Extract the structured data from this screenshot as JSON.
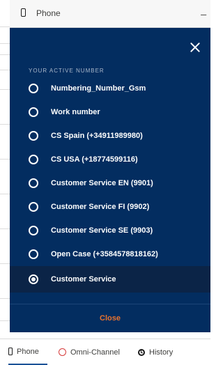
{
  "header": {
    "title": "Phone",
    "minimize_label": "_"
  },
  "panel": {
    "section_label": "YOUR ACTIVE NUMBER",
    "options": [
      {
        "label": "Numbering_Number_Gsm",
        "selected": false
      },
      {
        "label": "Work number",
        "selected": false
      },
      {
        "label": "CS Spain (+34911989980)",
        "selected": false
      },
      {
        "label": "CS USA (+18774599116)",
        "selected": false
      },
      {
        "label": "Customer Service EN (9901)",
        "selected": false
      },
      {
        "label": "Customer Service FI (9902)",
        "selected": false
      },
      {
        "label": "Customer Service SE (9903)",
        "selected": false
      },
      {
        "label": "Open Case (+3584578818162)",
        "selected": false
      },
      {
        "label": "Customer Service",
        "selected": true
      }
    ],
    "close_label": "Close"
  },
  "utility_bar": {
    "tabs": [
      {
        "label": "Phone",
        "icon": "phone-icon",
        "active": true
      },
      {
        "label": "Omni-Channel",
        "icon": "omni-channel-icon",
        "active": false
      },
      {
        "label": "History",
        "icon": "history-icon",
        "active": false
      }
    ]
  },
  "colors": {
    "panel_bg": "#032d60",
    "selected_bg": "#0b2447",
    "close_text": "#e8732e",
    "omni_icon": "#d63a3a",
    "active_tab_underline": "#1b5297"
  }
}
